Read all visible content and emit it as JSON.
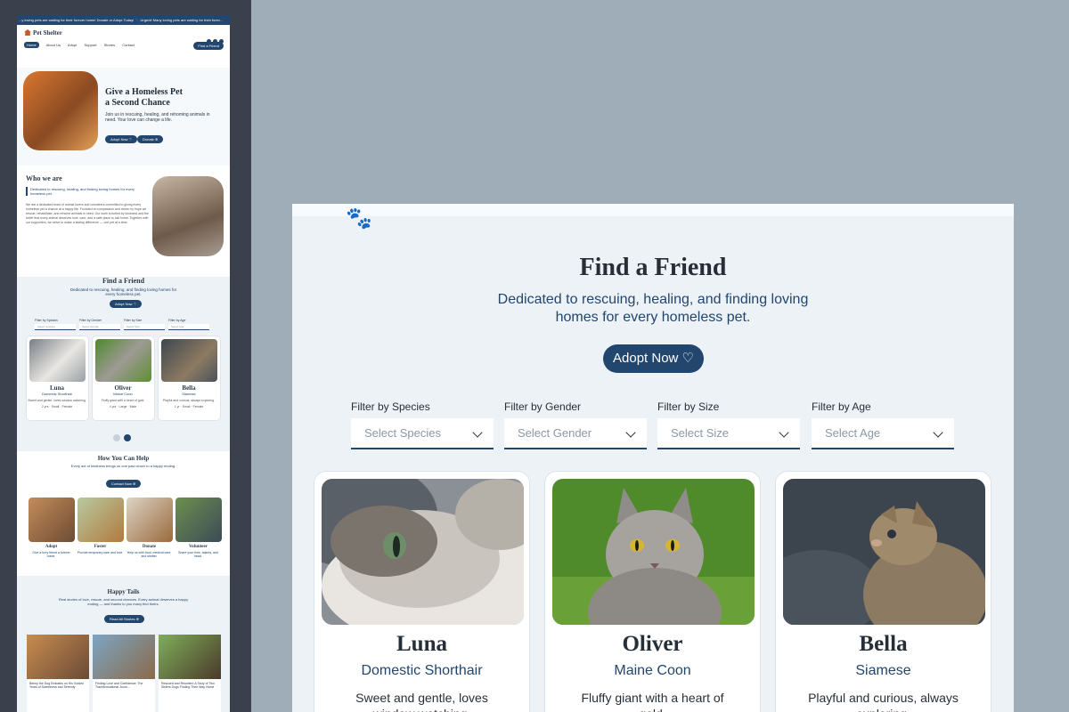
{
  "ticker": "...y loving pets are waiting for their forever home! Donate or Adopt Today!  🐾  Urgent! Many loving pets are waiting for their forev...",
  "site": {
    "name": "Pet Shelter",
    "nav": [
      "Home",
      "About Us",
      "Adopt",
      "Support",
      "Stories",
      "Contact"
    ],
    "find_button": "Find a Friend"
  },
  "hero": {
    "title_line1": "Give a Homeless Pet",
    "title_line2": "a Second Chance",
    "text": "Join us in rescuing, healing, and rehoming animals in need. Your love can change a life.",
    "adopt_label": "Adopt Now ♡",
    "donate_label": "Donate ⊕"
  },
  "who": {
    "title": "Who we are",
    "lead": "Dedicated to rescuing, healing, and finding loving homes for every homeless pet.",
    "body": "We are a dedicated team of animal lovers and volunteers committed to giving every homeless pet a chance at a happy life. Founded on compassion and driven by hope we rescue, rehabilitate, and rehome animals in need. Our work is fueled by kindness and the belief that every animal deserves love, care, and a safe place to call home. Together with our supporters, we strive to make a lasting difference — one pet at a time."
  },
  "find": {
    "title": "Find a Friend",
    "subtitle": "Dedicated to rescuing, healing, and finding loving homes for every homeless pet.",
    "adopt_label": "Adopt Now ♡",
    "filters": [
      {
        "label": "Filter by Species",
        "placeholder": "Select Species"
      },
      {
        "label": "Filter by Gender",
        "placeholder": "Select Gender"
      },
      {
        "label": "Filter by Size",
        "placeholder": "Select Size"
      },
      {
        "label": "Filter by Age",
        "placeholder": "Select Age"
      }
    ],
    "pets": [
      {
        "name": "Luna",
        "breed": "Domestic Shorthair",
        "desc": "Sweet and gentle, loves window watching.",
        "age": "2 yrs",
        "size": "Small",
        "gender": "Female"
      },
      {
        "name": "Oliver",
        "breed": "Maine Coon",
        "desc": "Fluffy giant with a heart of gold.",
        "age": "4 yrs",
        "size": "Large",
        "gender": "Male"
      },
      {
        "name": "Bella",
        "breed": "Siamese",
        "desc": "Playful and curious, always exploring.",
        "age": "1 yr",
        "size": "Small",
        "gender": "Female"
      }
    ]
  },
  "help": {
    "title": "How You Can Help",
    "subtitle": "Every act of kindness brings us one paw closer to a happy ending.",
    "contact_label": "Contact Now ⊕",
    "items": [
      {
        "title": "Adopt",
        "text": "Give a furry friend a forever home."
      },
      {
        "title": "Foster",
        "text": "Provide temporary care and love."
      },
      {
        "title": "Donate",
        "text": "Help us with food, medical care, and shelter."
      },
      {
        "title": "Volunteer",
        "text": "Share your time, talents, and heart."
      }
    ]
  },
  "tails": {
    "title": "Happy Tails",
    "subtitle": "Real stories of love, rescue, and second chances. Every animal deserves a happy ending — and thanks to you many find theirs.",
    "read_label": "Read All Stories ⊕",
    "stories": [
      "Benny the Dog Embarks on His Golden Years of Sweetness and Serenity",
      "Finding Love and Confidence: The Transformational Journ...",
      "Rescued and Reunited: A Story of Two Sisters Dogs Finding Their Way Home"
    ]
  },
  "colors": {
    "navy": "#22466e",
    "accent": "#c9582f"
  }
}
